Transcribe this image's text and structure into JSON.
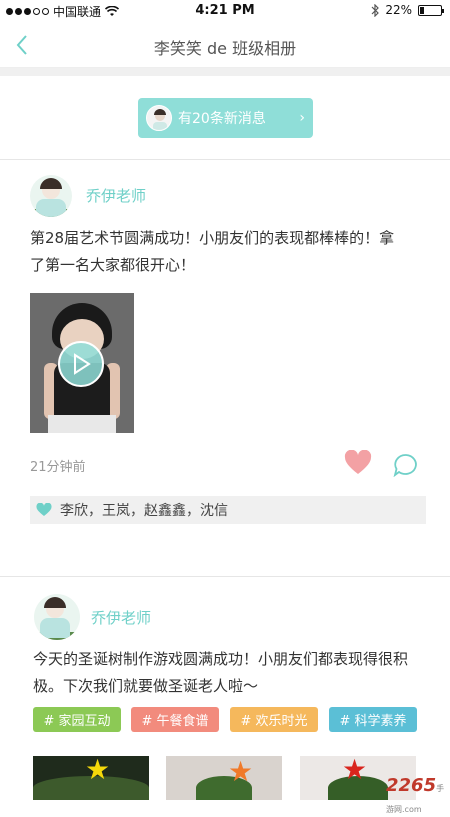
{
  "status_bar": {
    "carrier": "中国联通",
    "time": "4:21 PM",
    "battery": "22%",
    "battery_level": 0.22
  },
  "nav": {
    "title": "李笑笑 de 班级相册",
    "back_icon": "chevron-left-icon"
  },
  "banner": {
    "text": "有20条新消息",
    "chevron": "›"
  },
  "posts": [
    {
      "author": "乔伊老师",
      "text_line1": "第28届艺术节圆满成功！小朋友们的表现都棒棒的！拿",
      "text_line2": "了第一名大家都很开心！",
      "time": "21分钟前",
      "likes": "李欣，王岚，赵鑫鑫，沈信"
    },
    {
      "author": "乔伊老师",
      "text_line1": "今天的圣诞树制作游戏圆满成功！小朋友们都表现得很积",
      "text_line2": "极。下次我们就要做圣诞老人啦～",
      "tags": [
        "# 家园互动",
        "# 午餐食谱",
        "# 欢乐时光",
        "# 科学素养"
      ]
    }
  ],
  "colors": {
    "accent": "#6fd0c8",
    "banner": "#8fded8",
    "heart": "#f3a1a4",
    "tag_green": "#8cc955",
    "tag_red": "#f28b7d",
    "tag_orange": "#f5b85c",
    "tag_blue": "#5bbfd6"
  },
  "watermark": {
    "brand": "2265",
    "sub": "手游网",
    "url": ".com"
  }
}
